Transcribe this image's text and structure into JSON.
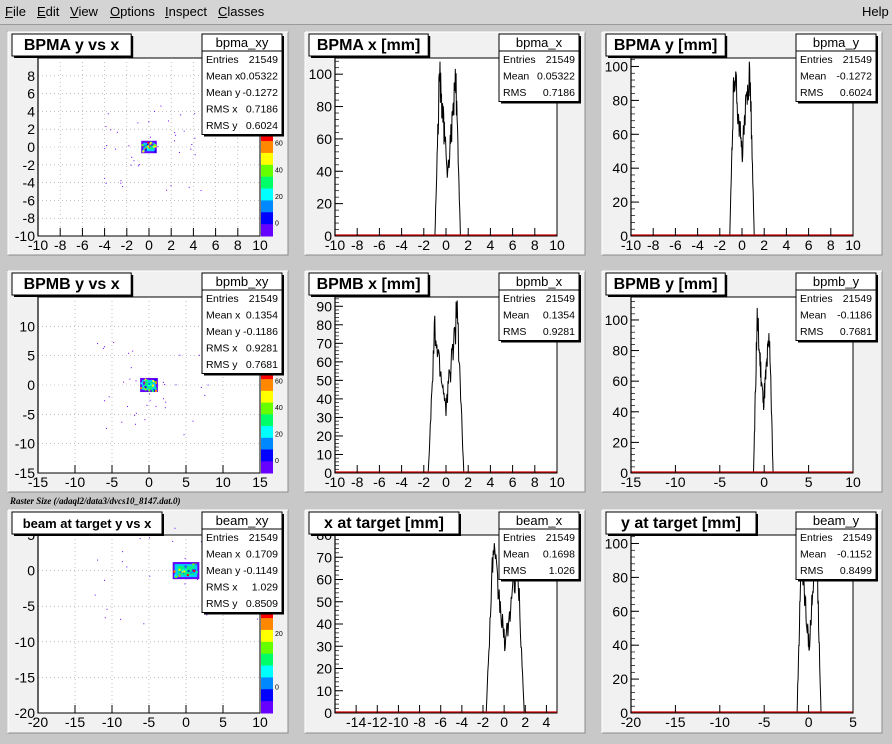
{
  "menu": {
    "items": [
      {
        "label": "File",
        "key": "F"
      },
      {
        "label": "Edit",
        "key": "E"
      },
      {
        "label": "View",
        "key": "V"
      },
      {
        "label": "Options",
        "key": "O"
      },
      {
        "label": "Inspect",
        "key": "I"
      },
      {
        "label": "Classes",
        "key": "C"
      }
    ],
    "help": "Help"
  },
  "canvas_note": "Raster Size (/adaql2/data3/dvcs10_8147.dat.0)",
  "colors": {
    "pad_bg": "#f1f1f1",
    "frame_bg": "#ffffff",
    "axis_tick": "#cc0000",
    "palette": [
      "#ff0000",
      "#ff8800",
      "#ffff00",
      "#66ff00",
      "#00ff66",
      "#00ffff",
      "#0088ff",
      "#0000ff",
      "#6600ff"
    ]
  },
  "chart_data": [
    {
      "id": "bpma_xy",
      "type": "heatmap",
      "title": "BPMA y vs x",
      "xlim": [
        -10,
        10
      ],
      "ylim": [
        -10,
        10
      ],
      "xticks": [
        -10,
        -8,
        -6,
        -4,
        -2,
        0,
        2,
        4,
        6,
        8,
        10
      ],
      "yticks": [
        -10,
        -8,
        -6,
        -4,
        -2,
        0,
        2,
        4,
        6,
        8,
        10
      ],
      "yticks_shown": [
        "8",
        "6",
        "4",
        "2",
        "0",
        "-2",
        "-4",
        "-6",
        "-8",
        "-10"
      ],
      "blob": {
        "x": [
          -0.7,
          0.7
        ],
        "y": [
          -0.7,
          0.7
        ]
      },
      "zticks": [
        "60",
        "40",
        "20",
        "0"
      ],
      "stats": {
        "name": "bpma_xy",
        "rows": [
          [
            "Entries",
            "21549"
          ],
          [
            "Mean x",
            "0.05322"
          ],
          [
            "Mean y",
            "-0.1272"
          ],
          [
            "RMS x",
            "0.7186"
          ],
          [
            "RMS y",
            "0.6024"
          ]
        ]
      }
    },
    {
      "id": "bpma_x",
      "type": "histogram",
      "title": "BPMA x [mm]",
      "xlim": [
        -10,
        10
      ],
      "ylim": [
        0,
        110
      ],
      "xticks": [
        -10,
        -8,
        -6,
        -4,
        -2,
        0,
        2,
        4,
        6,
        8,
        10
      ],
      "yticks": [
        0,
        20,
        40,
        60,
        80,
        100
      ],
      "shape": {
        "lo": -1.0,
        "hi": 1.3,
        "peakL": 100,
        "peakR": 96,
        "valley": 38
      },
      "stats": {
        "name": "bpma_x",
        "rows": [
          [
            "Entries",
            "21549"
          ],
          [
            "Mean",
            "0.05322"
          ],
          [
            "RMS",
            "0.7186"
          ]
        ]
      }
    },
    {
      "id": "bpma_y",
      "type": "histogram",
      "title": "BPMA y [mm]",
      "xlim": [
        -10,
        10
      ],
      "ylim": [
        0,
        105
      ],
      "xticks": [
        -10,
        -8,
        -6,
        -4,
        -2,
        0,
        2,
        4,
        6,
        8,
        10
      ],
      "yticks": [
        0,
        20,
        40,
        60,
        80,
        100
      ],
      "shape": {
        "lo": -1.1,
        "hi": 1.1,
        "peakL": 100,
        "peakR": 100,
        "valley": 48
      },
      "stats": {
        "name": "bpma_y",
        "rows": [
          [
            "Entries",
            "21549"
          ],
          [
            "Mean",
            "-0.1272"
          ],
          [
            "RMS",
            "0.6024"
          ]
        ]
      }
    },
    {
      "id": "bpmb_xy",
      "type": "heatmap",
      "title": "BPMB y vs x",
      "xlim": [
        -15,
        15
      ],
      "ylim": [
        -15,
        15
      ],
      "xticks": [
        -15,
        -10,
        -5,
        0,
        5,
        10,
        15
      ],
      "yticks": [
        -15,
        -10,
        -5,
        0,
        5,
        10,
        15
      ],
      "yticks_shown": [
        "10",
        "5",
        "0",
        "-5",
        "-10",
        "-15"
      ],
      "blob": {
        "x": [
          -1.2,
          1.2
        ],
        "y": [
          -1.2,
          1.2
        ]
      },
      "zticks": [
        "60",
        "40",
        "20",
        "0"
      ],
      "stats": {
        "name": "bpmb_xy",
        "rows": [
          [
            "Entries",
            "21549"
          ],
          [
            "Mean x",
            "0.1354"
          ],
          [
            "Mean y",
            "-0.1186"
          ],
          [
            "RMS x",
            "0.9281"
          ],
          [
            "RMS y",
            "0.7681"
          ]
        ]
      }
    },
    {
      "id": "bpmb_x",
      "type": "histogram",
      "title": "BPMB x [mm]",
      "xlim": [
        -10,
        10
      ],
      "ylim": [
        0,
        95
      ],
      "xticks": [
        -10,
        -8,
        -6,
        -4,
        -2,
        0,
        2,
        4,
        6,
        8,
        10
      ],
      "yticks": [
        0,
        10,
        20,
        30,
        40,
        50,
        60,
        70,
        80,
        90
      ],
      "shape": {
        "lo": -1.6,
        "hi": 1.6,
        "peakL": 76,
        "peakR": 88,
        "valley": 35
      },
      "stats": {
        "name": "bpmb_x",
        "rows": [
          [
            "Entries",
            "21549"
          ],
          [
            "Mean",
            "0.1354"
          ],
          [
            "RMS",
            "0.9281"
          ]
        ]
      }
    },
    {
      "id": "bpmb_y",
      "type": "histogram",
      "title": "BPMB y [mm]",
      "xlim": [
        -15,
        10
      ],
      "ylim": [
        0,
        115
      ],
      "xticks": [
        -15,
        -10,
        -5,
        0,
        5,
        10
      ],
      "yticks": [
        0,
        20,
        40,
        60,
        80,
        100
      ],
      "shape": {
        "lo": -1.2,
        "hi": 1.0,
        "peakL": 100,
        "peakR": 90,
        "valley": 45
      },
      "stats": {
        "name": "bpmb_y",
        "rows": [
          [
            "Entries",
            "21549"
          ],
          [
            "Mean",
            "-0.1186"
          ],
          [
            "RMS",
            "0.7681"
          ]
        ]
      }
    },
    {
      "id": "beam_xy",
      "type": "heatmap",
      "title": "beam at target y vs x",
      "xlim": [
        -20,
        10
      ],
      "ylim": [
        -20,
        5
      ],
      "xticks": [
        -20,
        -15,
        -10,
        -5,
        0,
        5,
        10
      ],
      "yticks": [
        -20,
        -15,
        -10,
        -5,
        0,
        5
      ],
      "yticks_shown": [
        "5",
        "0",
        "-5",
        "-10",
        "-15",
        "-20"
      ],
      "blob": {
        "x": [
          -1.8,
          1.8
        ],
        "y": [
          -1.2,
          1.2
        ]
      },
      "zticks": [
        "20",
        "0"
      ],
      "stats": {
        "name": "beam_xy",
        "rows": [
          [
            "Entries",
            "21549"
          ],
          [
            "Mean x",
            "0.1709"
          ],
          [
            "Mean y",
            "-0.1149"
          ],
          [
            "RMS x",
            "1.029"
          ],
          [
            "RMS y",
            "0.8509"
          ]
        ]
      }
    },
    {
      "id": "beam_x",
      "type": "histogram",
      "title": "x at target [mm]",
      "xlim": [
        -16,
        5
      ],
      "ylim": [
        0,
        80
      ],
      "xticks": [
        -14,
        -12,
        -10,
        -8,
        -6,
        -4,
        -2,
        0,
        2,
        4
      ],
      "yticks": [
        0,
        10,
        20,
        30,
        40,
        50,
        60,
        70,
        80
      ],
      "shape": {
        "lo": -1.7,
        "hi": 1.9,
        "peakL": 73,
        "peakR": 70,
        "valley": 30
      },
      "stats": {
        "name": "beam_x",
        "rows": [
          [
            "Entries",
            "21549"
          ],
          [
            "Mean",
            "0.1698"
          ],
          [
            "RMS",
            "1.026"
          ]
        ]
      }
    },
    {
      "id": "beam_y",
      "type": "histogram",
      "title": "y at target [mm]",
      "xlim": [
        -20,
        5
      ],
      "ylim": [
        0,
        105
      ],
      "xticks": [
        -20,
        -15,
        -10,
        -5,
        0,
        5
      ],
      "yticks": [
        0,
        20,
        40,
        60,
        80,
        100
      ],
      "shape": {
        "lo": -1.3,
        "hi": 1.4,
        "peakL": 95,
        "peakR": 100,
        "valley": 40
      },
      "stats": {
        "name": "beam_y",
        "rows": [
          [
            "Entries",
            "21549"
          ],
          [
            "Mean",
            "-0.1152"
          ],
          [
            "RMS",
            "0.8499"
          ]
        ]
      }
    }
  ]
}
